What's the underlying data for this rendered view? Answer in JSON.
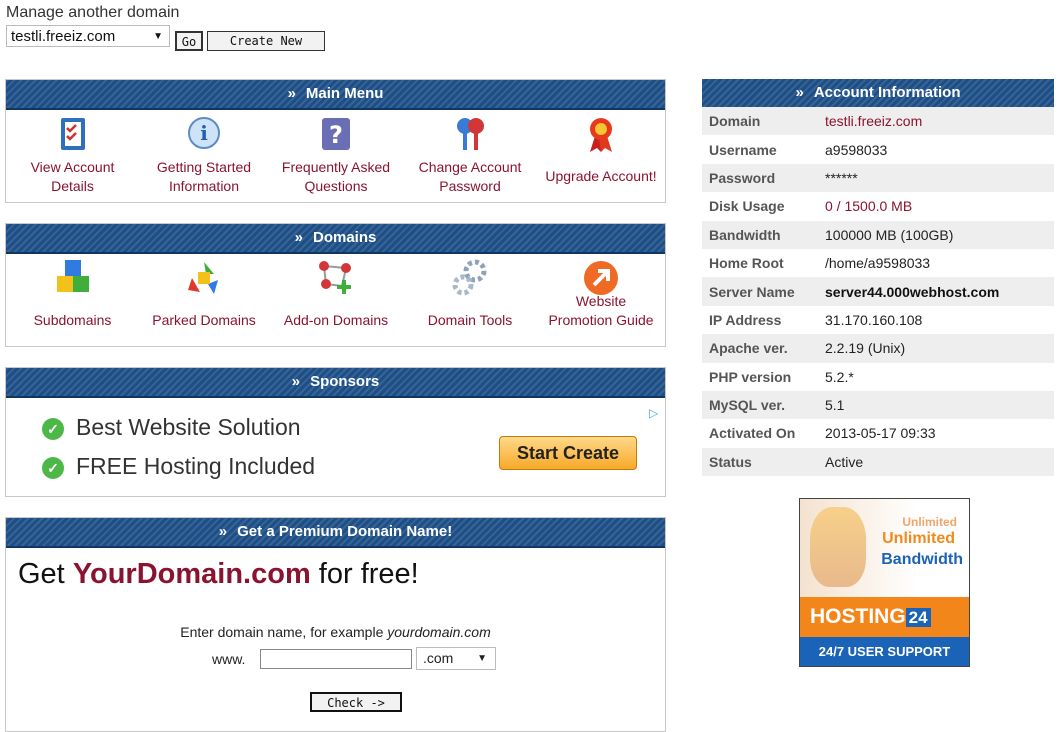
{
  "manage": {
    "label": "Manage another domain",
    "selected_domain": "testli.freeiz.com",
    "go_label": "Go",
    "create_label": "Create New"
  },
  "main_menu": {
    "title": "Main Menu",
    "items": [
      {
        "line1": "View Account",
        "line2": "Details",
        "icon": "clipboard-checklist-icon"
      },
      {
        "line1": "Getting Started",
        "line2": "Information",
        "icon": "info-bubble-icon"
      },
      {
        "line1": "Frequently Asked",
        "line2": "Questions",
        "icon": "question-mark-icon"
      },
      {
        "line1": "Change Account",
        "line2": "Password",
        "icon": "keys-icon"
      },
      {
        "line1": "Upgrade Account!",
        "line2": "",
        "icon": "award-ribbon-icon"
      }
    ]
  },
  "domains": {
    "title": "Domains",
    "items": [
      {
        "line1": "Subdomains",
        "line2": "",
        "icon": "cubes-icon"
      },
      {
        "line1": "Parked Domains",
        "line2": "",
        "icon": "recycle-icon"
      },
      {
        "line1": "Add-on Domains",
        "line2": "",
        "icon": "molecule-add-icon"
      },
      {
        "line1": "Domain Tools",
        "line2": "",
        "icon": "gears-icon"
      },
      {
        "line1": "Website",
        "line2": "Promotion Guide",
        "icon": "arrow-circle-icon"
      }
    ]
  },
  "sponsors": {
    "title": "Sponsors",
    "line1": "Best Website Solution",
    "line2": "FREE Hosting Included",
    "cta": "Start Create"
  },
  "premium": {
    "title": "Get a Premium Domain Name!",
    "headline_pre": "Get ",
    "headline_domain": "YourDomain.com",
    "headline_post": " for free!",
    "enter_text": "Enter domain name, for example ",
    "example": "yourdomain.com",
    "www": "www.",
    "tld": ".com",
    "check_label": "Check ->"
  },
  "account": {
    "title": "Account Information",
    "rows": [
      {
        "key": "Domain",
        "value": "testli.freeiz.com"
      },
      {
        "key": "Username",
        "value": "a9598033"
      },
      {
        "key": "Password",
        "value": "******"
      },
      {
        "key": "Disk Usage",
        "value": "0 / 1500.0 MB"
      },
      {
        "key": "Bandwidth",
        "value": "100000 MB (100GB)"
      },
      {
        "key": "Home Root",
        "value": "/home/a9598033"
      },
      {
        "key": "Server Name",
        "value": "server44.000webhost.com"
      },
      {
        "key": "IP Address",
        "value": "31.170.160.108"
      },
      {
        "key": "Apache ver.",
        "value": "2.2.19 (Unix)"
      },
      {
        "key": "PHP version",
        "value": "5.2.*"
      },
      {
        "key": "MySQL ver.",
        "value": "5.1"
      },
      {
        "key": "Activated On",
        "value": "2013-05-17 09:33"
      },
      {
        "key": "Status",
        "value": "Active"
      }
    ]
  },
  "banner": {
    "small": "Unlimited",
    "line1": "Unlimited",
    "line2": "Bandwidth",
    "brand": "HOSTING",
    "brand_num": "24",
    "support": "24/7 USER SUPPORT"
  },
  "colors": {
    "header_blue": "#1d4f86",
    "label_red": "#8a1430",
    "green_check": "#4db848"
  }
}
